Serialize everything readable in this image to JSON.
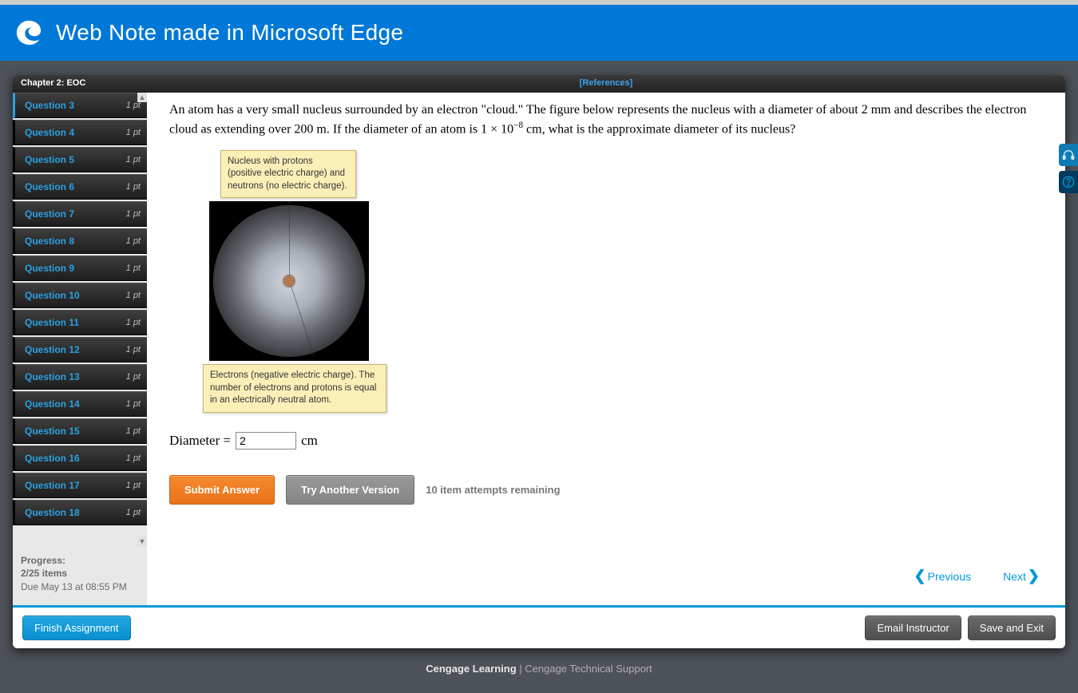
{
  "edge": {
    "title": "Web Note made in Microsoft Edge"
  },
  "topbar": {
    "chapter": "Chapter 2: EOC",
    "references": "[References]"
  },
  "sidebar": {
    "questions": [
      {
        "label": "Question 3",
        "pts": "1 pt"
      },
      {
        "label": "Question 4",
        "pts": "1 pt"
      },
      {
        "label": "Question 5",
        "pts": "1 pt"
      },
      {
        "label": "Question 6",
        "pts": "1 pt"
      },
      {
        "label": "Question 7",
        "pts": "1 pt"
      },
      {
        "label": "Question 8",
        "pts": "1 pt"
      },
      {
        "label": "Question 9",
        "pts": "1 pt"
      },
      {
        "label": "Question 10",
        "pts": "1 pt"
      },
      {
        "label": "Question 11",
        "pts": "1 pt"
      },
      {
        "label": "Question 12",
        "pts": "1 pt"
      },
      {
        "label": "Question 13",
        "pts": "1 pt"
      },
      {
        "label": "Question 14",
        "pts": "1 pt"
      },
      {
        "label": "Question 15",
        "pts": "1 pt"
      },
      {
        "label": "Question 16",
        "pts": "1 pt"
      },
      {
        "label": "Question 17",
        "pts": "1 pt"
      },
      {
        "label": "Question 18",
        "pts": "1 pt"
      }
    ],
    "progress_label": "Progress:",
    "progress_value": "2/25 items",
    "due": "Due May 13 at 08:55 PM"
  },
  "question": {
    "text_1": "An atom has a very small nucleus surrounded by an electron \"cloud.\" The figure below represents the nucleus with a diameter of about 2 mm and describes the electron cloud as extending over 200 m. If the diameter of an atom is 1 × 10",
    "exponent": "−8",
    "text_2": " cm, what is the approximate diameter of its nucleus?",
    "callout_top": "Nucleus with protons (positive electric charge) and neutrons (no electric charge).",
    "callout_bottom": "Electrons (negative electric charge). The number of electrons and protons is equal in an electrically neutral atom.",
    "answer_label": "Diameter =",
    "answer_value": "2",
    "answer_unit": "cm"
  },
  "actions": {
    "submit": "Submit Answer",
    "try_another": "Try Another Version",
    "attempts": "10 item attempts remaining",
    "previous": "Previous",
    "next": "Next"
  },
  "footer": {
    "finish": "Finish Assignment",
    "email": "Email Instructor",
    "save": "Save and Exit"
  },
  "pagefoot": {
    "brand": "Cengage Learning",
    "sep": "  |  ",
    "support": "Cengage Technical Support"
  }
}
